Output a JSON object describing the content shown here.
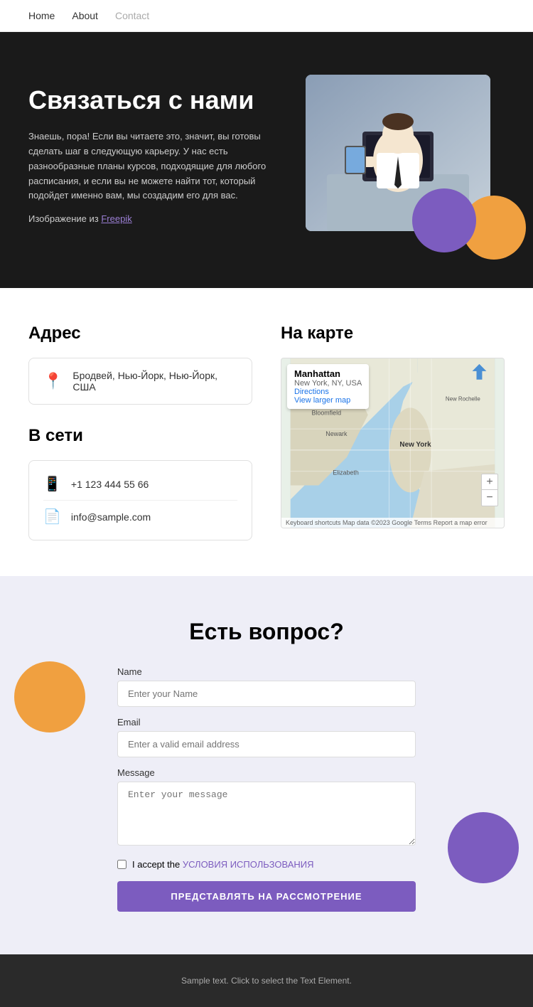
{
  "nav": {
    "items": [
      {
        "label": "Home",
        "active": false
      },
      {
        "label": "About",
        "active": false
      },
      {
        "label": "Contact",
        "active": true
      }
    ]
  },
  "hero": {
    "title": "Связаться с нами",
    "body": "Знаешь, пора! Если вы читаете это, значит, вы готовы сделать шаг в следующую карьеру. У нас есть разнообразные планы курсов, подходящие для любого расписания, и если вы не можете найти тот, который подойдет именно вам, мы создадим его для вас.",
    "image_credit_prefix": "Изображение из ",
    "image_credit_link": "Freepik"
  },
  "contact": {
    "address_title": "Адрес",
    "address_value": "Бродвей, Нью-Йорк, Нью-Йорк, США",
    "network_title": "В сети",
    "phone": "+1 123 444 55 66",
    "email": "info@sample.com",
    "map_title": "На карте",
    "map_city": "Manhattan",
    "map_state": "New York, NY, USA",
    "map_directions": "Directions",
    "map_view_larger": "View larger map",
    "map_footer": "Keyboard shortcuts  Map data ©2023 Google  Terms  Report a map error"
  },
  "form": {
    "title": "Есть вопрос?",
    "name_label": "Name",
    "name_placeholder": "Enter your Name",
    "email_label": "Email",
    "email_placeholder": "Enter a valid email address",
    "message_label": "Message",
    "message_placeholder": "Enter your message",
    "checkbox_prefix": "I accept the ",
    "terms_link": "УСЛОВИЯ ИСПОЛЬЗОВАНИЯ",
    "submit_label": "ПРЕДСТАВЛЯТЬ НА РАССМОТРЕНИЕ"
  },
  "footer": {
    "text": "Sample text. Click to select the Text Element."
  }
}
